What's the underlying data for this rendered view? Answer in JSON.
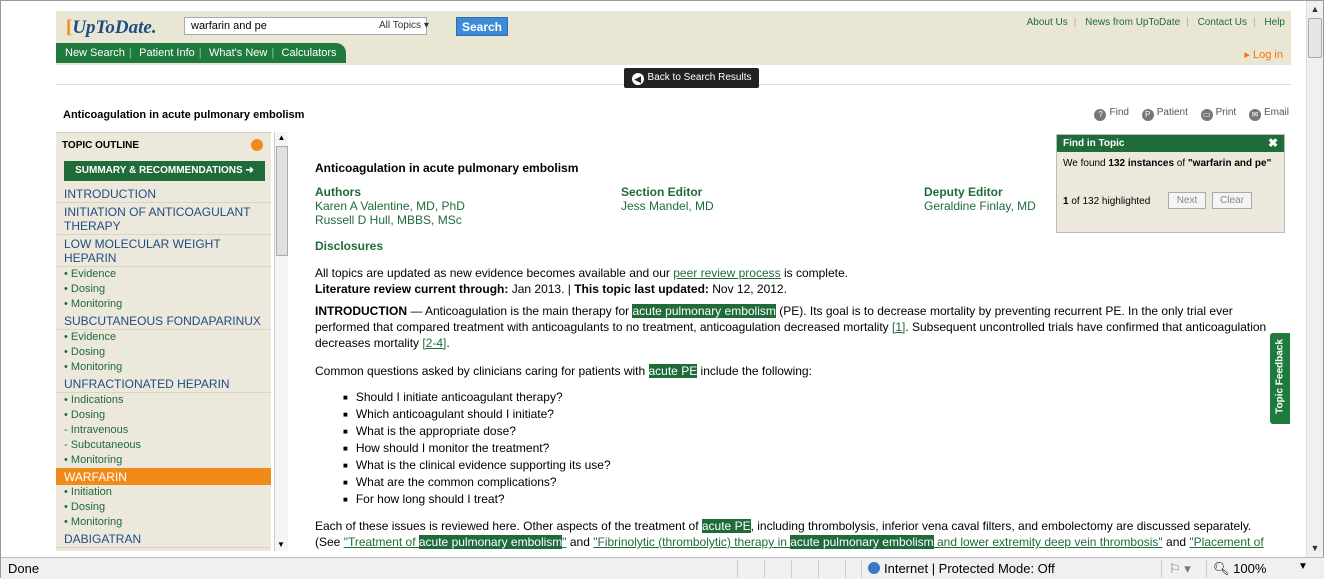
{
  "header": {
    "logo": "UpToDate.",
    "search_value": "warfarin and pe",
    "topic_select": "All Topics",
    "search_button": "Search",
    "links": [
      "About Us",
      "News from UpToDate",
      "Contact Us",
      "Help"
    ],
    "nav": [
      "New Search",
      "Patient Info",
      "What's New",
      "Calculators"
    ],
    "login": "Log in"
  },
  "back_button": "Back to Search Results",
  "page_title": "Anticoagulation in acute pulmonary embolism",
  "tools": [
    "Find",
    "Patient",
    "Print",
    "Email"
  ],
  "outline": {
    "title": "TOPIC OUTLINE",
    "summary_button": "SUMMARY & RECOMMENDATIONS",
    "items": [
      {
        "type": "sec",
        "label": "INTRODUCTION"
      },
      {
        "type": "sec",
        "label": "INITIATION OF ANTICOAGULANT THERAPY"
      },
      {
        "type": "sec",
        "label": "LOW MOLECULAR WEIGHT HEPARIN"
      },
      {
        "type": "item",
        "label": "• Evidence"
      },
      {
        "type": "item",
        "label": "• Dosing"
      },
      {
        "type": "item",
        "label": "• Monitoring"
      },
      {
        "type": "sec",
        "label": "SUBCUTANEOUS FONDAPARINUX"
      },
      {
        "type": "item",
        "label": "• Evidence"
      },
      {
        "type": "item",
        "label": "• Dosing"
      },
      {
        "type": "item",
        "label": "• Monitoring"
      },
      {
        "type": "sec",
        "label": "UNFRACTIONATED HEPARIN"
      },
      {
        "type": "item",
        "label": "• Indications"
      },
      {
        "type": "item",
        "label": "• Dosing"
      },
      {
        "type": "sub",
        "label": "- Intravenous"
      },
      {
        "type": "sub",
        "label": "- Subcutaneous"
      },
      {
        "type": "item",
        "label": "• Monitoring"
      },
      {
        "type": "active",
        "label": "WARFARIN"
      },
      {
        "type": "item",
        "label": "• Initiation"
      },
      {
        "type": "item",
        "label": "• Dosing"
      },
      {
        "type": "item",
        "label": "• Monitoring"
      },
      {
        "type": "sec",
        "label": "DABIGATRAN"
      }
    ]
  },
  "article": {
    "title": "Anticoagulation in acute pulmonary embolism",
    "authors_label": "Authors",
    "authors": [
      "Karen A Valentine, MD, PhD",
      "Russell D Hull, MBBS, MSc"
    ],
    "section_editor_label": "Section Editor",
    "section_editor": "Jess Mandel, MD",
    "deputy_editor_label": "Deputy Editor",
    "deputy_editor": "Geraldine Finlay, MD",
    "disclosures": "Disclosures",
    "update_pre": "All topics are updated as new evidence becomes available and our ",
    "update_link": "peer review process",
    "update_post": " is complete.",
    "review_label": "Literature review current through:",
    "review_date": " Jan 2013. | ",
    "updated_label": "This topic last updated:",
    "updated_date": " Nov 12, 2012.",
    "intro_label": "INTRODUCTION",
    "intro_1": " — Anticoagulation is the main therapy for ",
    "hl_ape": "acute pulmonary embolism",
    "intro_2": " (PE). Its goal is to decrease mortality by preventing recurrent PE. In the only trial ever performed that compared treatment with anticoagulants to no treatment, anticoagulation decreased mortality ",
    "ref1": "[1]",
    "intro_3": ". Subsequent uncontrolled trials have confirmed that anticoagulation decreases mortality ",
    "ref2": "[2-4]",
    "intro_4": ".",
    "common_1": "Common questions asked by clinicians caring for patients with ",
    "hl_acute_pe": "acute PE",
    "common_2": " include the following:",
    "questions": [
      "Should I initiate anticoagulant therapy?",
      "Which anticoagulant should I initiate?",
      "What is the appropriate dose?",
      "How should I monitor the treatment?",
      "What is the clinical evidence supporting its use?",
      "What are the common complications?",
      "For how long should I treat?"
    ],
    "each_1": "Each of these issues is reviewed here. Other aspects of the treatment of ",
    "each_2": ", including thrombolysis, inferior vena caval filters, and embolectomy are discussed separately. (See ",
    "link1_a": "\"Treatment of ",
    "link1_b": "\"",
    "and1": " and ",
    "link2_a": "\"Fibrinolytic (thrombolytic) therapy in ",
    "link2_b": " and lower extremity deep vein thrombosis\"",
    "and2": " and ",
    "link3": "\"Placement of inferior vena cava filters and their complications\"",
    "end": ".)"
  },
  "find": {
    "title": "Find in Topic",
    "msg_pre": "We found ",
    "msg_bold": "132 instances",
    "msg_mid": " of ",
    "msg_query": "\"warfarin and pe\"",
    "count_bold": "1",
    "count_rest": " of 132 highlighted",
    "next": "Next",
    "clear": "Clear"
  },
  "feedback": "Topic Feedback",
  "status": {
    "text": "Done",
    "zone": "Internet | Protected Mode: Off",
    "zoom": "100%"
  }
}
